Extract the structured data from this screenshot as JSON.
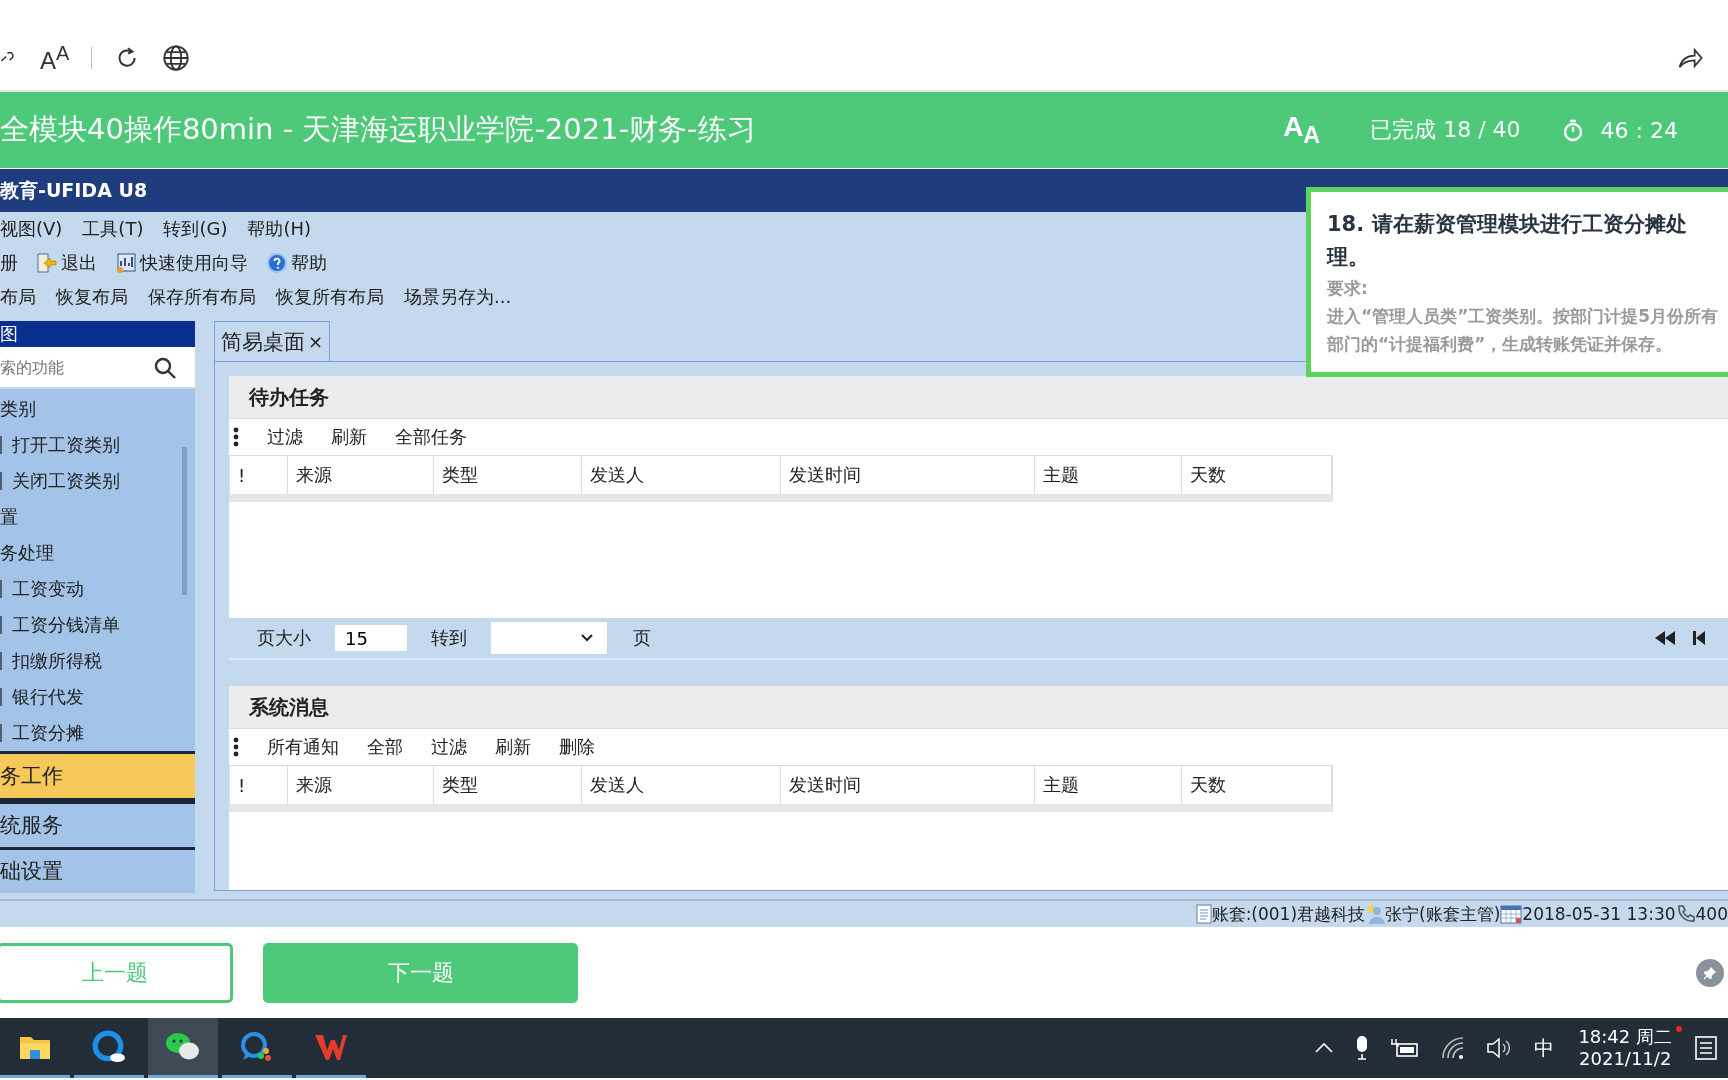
{
  "browser_toolbar": {
    "font_button": "A$^{A}$"
  },
  "header": {
    "title": "全模块40操作80min - 天津海运职业学院-2021-财务-练习",
    "font_button": "A$_{A}$",
    "progress": "已完成 18 / 40",
    "timer": "46 : 24"
  },
  "app": {
    "title": "教育-UFIDA U8",
    "menu": [
      "视图(V)",
      "工具(T)",
      "转到(G)",
      "帮助(H)"
    ],
    "toolbar": [
      {
        "label": "册",
        "kind": "plain"
      },
      {
        "label": "退出",
        "kind": "exit"
      },
      {
        "label": "快速使用向导",
        "kind": "wizard"
      },
      {
        "label": "帮助",
        "kind": "help"
      }
    ],
    "layout_bar": [
      "布局",
      "恢复布局",
      "保存所有布局",
      "恢复所有布局",
      "场景另存为..."
    ],
    "sidebar": {
      "title": "图",
      "search": {
        "placeholder": "索的功能"
      },
      "tree": [
        {
          "label": "类别",
          "children": [
            {
              "label": "打开工资类别"
            },
            {
              "label": "关闭工资类别"
            }
          ]
        },
        {
          "label": "置"
        },
        {
          "label": "务处理",
          "children": [
            {
              "label": "工资变动"
            },
            {
              "label": "工资分钱清单"
            },
            {
              "label": "扣缴所得税"
            },
            {
              "label": "银行代发"
            },
            {
              "label": "工资分摊"
            }
          ]
        }
      ],
      "sections": [
        {
          "label": "务工作",
          "selected": true
        },
        {
          "label": "统服务",
          "selected": false
        },
        {
          "label": "础设置",
          "selected": false
        }
      ]
    },
    "tabs": [
      {
        "label": "简易桌面",
        "close": "×",
        "selected": true
      }
    ],
    "panels": [
      {
        "title": "待办任务",
        "actions": [
          "过滤",
          "刷新",
          "全部任务"
        ],
        "columns": [
          "!",
          "来源",
          "类型",
          "发送人",
          "发送时间",
          "主题",
          "天数"
        ],
        "pager": {
          "page_size_label": "页大小",
          "page_size": "15",
          "goto_label": "转到",
          "page_label": "页"
        }
      },
      {
        "title": "系统消息",
        "actions": [
          "所有通知",
          "全部",
          "过滤",
          "刷新",
          "删除"
        ],
        "columns": [
          "!",
          "来源",
          "类型",
          "发送人",
          "发送时间",
          "主题",
          "天数"
        ]
      }
    ],
    "status_bar": [
      {
        "kind": "ledger",
        "text": "账套:(001)君越科技"
      },
      {
        "kind": "user",
        "text": "张宁(账套主管)"
      },
      {
        "kind": "calendar",
        "text": "2018-05-31 13:30"
      },
      {
        "kind": "phone",
        "text": "400"
      }
    ]
  },
  "question": {
    "title": "18. 请在薪资管理模块进行工资分摊处理。",
    "requirement_label": "要求:",
    "requirement": "进入“管理人员类”工资类别。按部门计提5月份所有部门的“计提福利费”，生成转账凭证并保存。"
  },
  "nav_buttons": [
    {
      "label": "上一题",
      "kind": "outline"
    },
    {
      "label": "下一题",
      "kind": "filled"
    }
  ],
  "taskbar": {
    "apps": [
      {
        "kind": "folder",
        "selected": false
      },
      {
        "kind": "browser",
        "selected": false
      },
      {
        "kind": "chat",
        "selected": true
      },
      {
        "kind": "meeting",
        "selected": false
      },
      {
        "kind": "office",
        "selected": false
      }
    ],
    "ime": "中",
    "time": "18:42 周二",
    "date": "2021/11/2"
  }
}
